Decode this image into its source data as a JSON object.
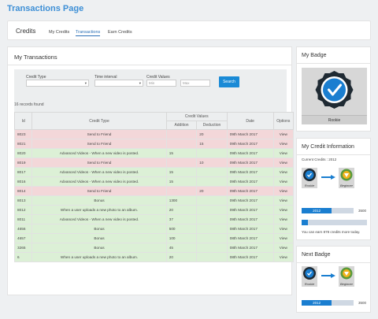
{
  "page": {
    "title": "Transactions Page"
  },
  "credits_nav": {
    "heading": "Credits",
    "tabs": [
      "My Credits",
      "Transactions",
      "Earn Credits"
    ],
    "active_tab": "Transactions"
  },
  "transactions": {
    "heading": "My Transactions",
    "filter": {
      "credit_type_label": "Credit Type",
      "time_interval_label": "Time interval",
      "credit_values_label": "Credit Values",
      "min_placeholder": "Min",
      "max_placeholder": "Max",
      "search_label": "Search"
    },
    "records_found": "16 records found",
    "columns": {
      "id": "Id",
      "credit_type": "Credit Type",
      "credit_values": "Credit Values",
      "addition": "Addition",
      "deduction": "Deduction",
      "date": "Date",
      "options": "Options"
    },
    "rows": [
      {
        "id": "8023",
        "type": "Send to Friend",
        "addition": "",
        "deduction": "20",
        "date": "09th March 2017",
        "option": "View",
        "status": "red"
      },
      {
        "id": "8021",
        "type": "Send to Friend",
        "addition": "",
        "deduction": "15",
        "date": "09th March 2017",
        "option": "View",
        "status": "red"
      },
      {
        "id": "8020",
        "type": "Advanced Videos - When a new video is posted.",
        "addition": "15",
        "deduction": "",
        "date": "09th March 2017",
        "option": "View",
        "status": "green"
      },
      {
        "id": "8019",
        "type": "Send to Friend",
        "addition": "",
        "deduction": "10",
        "date": "09th March 2017",
        "option": "View",
        "status": "red"
      },
      {
        "id": "8017",
        "type": "Advanced Videos - When a new video is posted.",
        "addition": "15",
        "deduction": "",
        "date": "09th March 2017",
        "option": "View",
        "status": "green"
      },
      {
        "id": "8016",
        "type": "Advanced Videos - When a new video is posted.",
        "addition": "15",
        "deduction": "",
        "date": "09th March 2017",
        "option": "View",
        "status": "green"
      },
      {
        "id": "8014",
        "type": "Send to Friend",
        "addition": "",
        "deduction": "20",
        "date": "09th March 2017",
        "option": "View",
        "status": "red"
      },
      {
        "id": "8013",
        "type": "Bonus",
        "addition": "1300",
        "deduction": "",
        "date": "09th March 2017",
        "option": "View",
        "status": "green"
      },
      {
        "id": "8012",
        "type": "When a user uploads a new photo to an album.",
        "addition": "20",
        "deduction": "",
        "date": "09th March 2017",
        "option": "View",
        "status": "green"
      },
      {
        "id": "8011",
        "type": "Advanced Videos - When a new video is posted.",
        "addition": "37",
        "deduction": "",
        "date": "09th March 2017",
        "option": "View",
        "status": "green"
      },
      {
        "id": "4656",
        "type": "Bonus",
        "addition": "500",
        "deduction": "",
        "date": "08th March 2017",
        "option": "View",
        "status": "green"
      },
      {
        "id": "4657",
        "type": "Bonus",
        "addition": "100",
        "deduction": "",
        "date": "08th March 2017",
        "option": "View",
        "status": "green"
      },
      {
        "id": "3265",
        "type": "Bonus",
        "addition": "45",
        "deduction": "",
        "date": "08th March 2017",
        "option": "View",
        "status": "green"
      },
      {
        "id": "6",
        "type": "When a user uploads a new photo to an album.",
        "addition": "20",
        "deduction": "",
        "date": "08th March 2017",
        "option": "View",
        "status": "green"
      }
    ]
  },
  "my_badge": {
    "heading": "My Badge",
    "badge_name": "Rookie"
  },
  "credit_info": {
    "heading": "My Credit Information",
    "current_credits": "Current Credits : 2012",
    "from_badge": "Rookie",
    "to_badge": "Beginner",
    "progress_value": "2012",
    "progress_max": "3500",
    "progress_fraction": 0.58,
    "secondary_fraction": 0.1,
    "earn_text": "You can earn 878 credits more today."
  },
  "next_badge": {
    "heading": "Next Badge",
    "from_badge": "Rookie",
    "to_badge": "Beginner",
    "progress_value": "2012",
    "progress_max": "3500",
    "progress_fraction": 0.58
  },
  "colors": {
    "accent": "#1a8ad6",
    "row_red": "#f3d7d9",
    "row_green": "#dcf0d6"
  }
}
